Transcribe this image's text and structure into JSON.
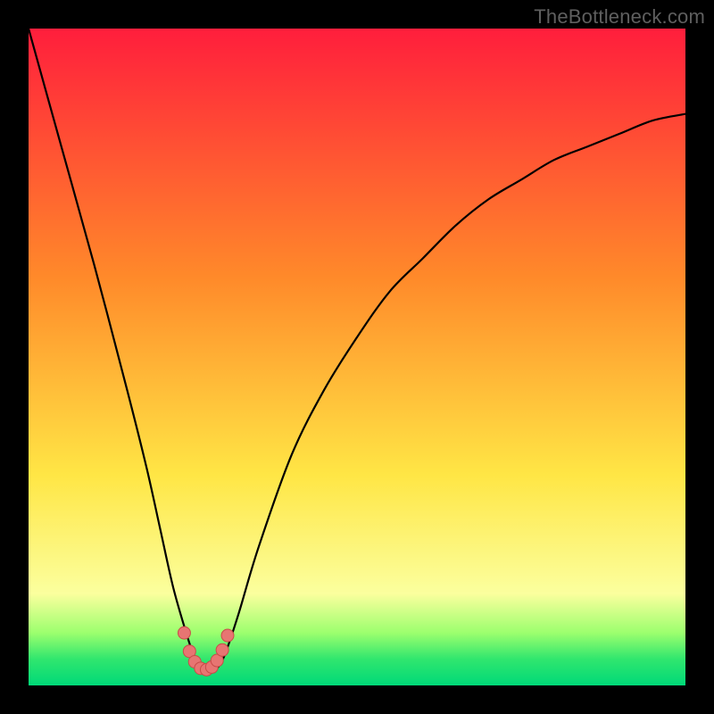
{
  "watermark": "TheBottleneck.com",
  "colors": {
    "top": "#FF1E3C",
    "orange": "#FF8A2A",
    "yellow": "#FFE645",
    "pale_yellow": "#FBFF9E",
    "green1": "#9CFF6E",
    "green2": "#30E66E",
    "green3": "#00D978",
    "curve": "#000000",
    "dot_fill": "#E77572",
    "dot_stroke": "#C94B48"
  },
  "chart_data": {
    "type": "line",
    "title": "",
    "xlabel": "",
    "ylabel": "",
    "xlim": [
      0,
      100
    ],
    "ylim": [
      0,
      100
    ],
    "series": [
      {
        "name": "bottleneck-curve",
        "x": [
          0,
          5,
          10,
          15,
          18,
          20,
          22,
          24,
          25,
          26,
          27,
          28,
          29,
          30,
          32,
          35,
          40,
          45,
          50,
          55,
          60,
          65,
          70,
          75,
          80,
          85,
          90,
          95,
          100
        ],
        "y": [
          100,
          82,
          64,
          45,
          33,
          24,
          15,
          8,
          5,
          3,
          2,
          2,
          3,
          5,
          11,
          21,
          35,
          45,
          53,
          60,
          65,
          70,
          74,
          77,
          80,
          82,
          84,
          86,
          87
        ]
      }
    ],
    "markers": {
      "name": "highlight-dots",
      "x": [
        23.7,
        24.5,
        25.3,
        26.2,
        27.1,
        27.9,
        28.7,
        29.5,
        30.3
      ],
      "y": [
        8.0,
        5.2,
        3.6,
        2.6,
        2.4,
        2.8,
        3.8,
        5.4,
        7.6
      ]
    },
    "gradient_stops": [
      {
        "offset": 0.0,
        "color_key": "top"
      },
      {
        "offset": 0.38,
        "color_key": "orange"
      },
      {
        "offset": 0.68,
        "color_key": "yellow"
      },
      {
        "offset": 0.86,
        "color_key": "pale_yellow"
      },
      {
        "offset": 0.92,
        "color_key": "green1"
      },
      {
        "offset": 0.96,
        "color_key": "green2"
      },
      {
        "offset": 1.0,
        "color_key": "green3"
      }
    ]
  }
}
